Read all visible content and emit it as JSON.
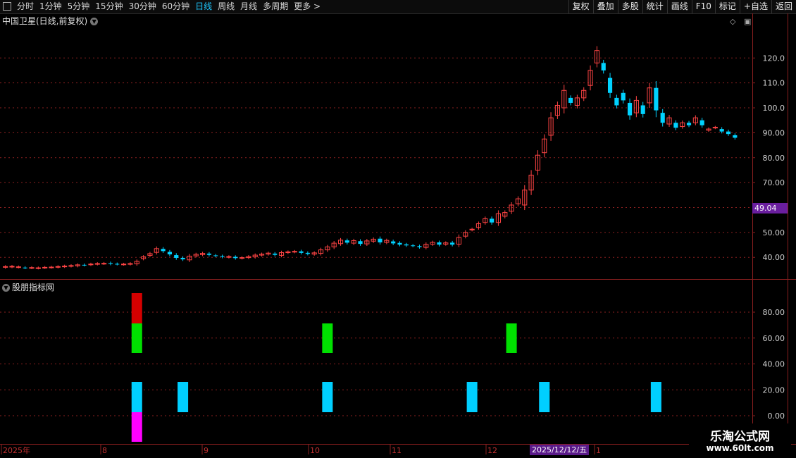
{
  "toolbar": {
    "tabs": [
      "分时",
      "1分钟",
      "5分钟",
      "15分钟",
      "30分钟",
      "60分钟",
      "日线",
      "周线",
      "月线",
      "多周期",
      "更多 >"
    ],
    "active_tab": "日线",
    "right_buttons": [
      "复权",
      "叠加",
      "多股",
      "统计",
      "画线",
      "F10",
      "标记",
      "+自选",
      "返回"
    ]
  },
  "main": {
    "title": "中国卫星(日线,前复权)",
    "current_price": "49.04",
    "y_ticks": [
      "120.0",
      "110.0",
      "100.0",
      "90.00",
      "80.00",
      "70.00",
      "60.00",
      "50.00",
      "40.00"
    ]
  },
  "indicator": {
    "title": "股朋指标网",
    "y_ticks": [
      "80.00",
      "60.00",
      "40.00",
      "20.00",
      "0.00"
    ]
  },
  "x_axis": {
    "labels": [
      "2025年",
      "8",
      "9",
      "10",
      "11",
      "12",
      "1"
    ],
    "selected_date": "2025/12/12/五"
  },
  "watermark": {
    "name": "乐淘公式网",
    "url": "www.60lt.com"
  },
  "colors": {
    "up": "#ff4444",
    "down": "#00d2ff",
    "grid": "#8a1f1f",
    "bar_red": "#d40000",
    "bar_green": "#00e000",
    "bar_cyan": "#00cfff",
    "bar_magenta": "#ff00ff"
  },
  "chart_data": {
    "type": "candlestick",
    "price_range": [
      33,
      128
    ],
    "candles": [
      {
        "o": 36,
        "c": 36.3
      },
      {
        "o": 36.2,
        "c": 36.4
      },
      {
        "o": 36.1,
        "c": 36.2
      },
      {
        "o": 35.9,
        "c": 35.8
      },
      {
        "o": 35.8,
        "c": 35.9
      },
      {
        "o": 35.7,
        "c": 35.8
      },
      {
        "o": 35.9,
        "c": 36.0
      },
      {
        "o": 36.0,
        "c": 36.1
      },
      {
        "o": 36.1,
        "c": 36.3
      },
      {
        "o": 36.3,
        "c": 36.5
      },
      {
        "o": 36.5,
        "c": 36.7
      },
      {
        "o": 36.6,
        "c": 37.0
      },
      {
        "o": 37.0,
        "c": 36.9
      },
      {
        "o": 37.1,
        "c": 37.3
      },
      {
        "o": 37.3,
        "c": 37.5
      },
      {
        "o": 37.5,
        "c": 37.6
      },
      {
        "o": 37.7,
        "c": 37.4
      },
      {
        "o": 37.4,
        "c": 37.3
      },
      {
        "o": 37.2,
        "c": 37.3
      },
      {
        "o": 37.3,
        "c": 37.5
      },
      {
        "o": 37.4,
        "c": 38.4
      },
      {
        "o": 39.5,
        "c": 40.2
      },
      {
        "o": 40.8,
        "c": 41.5
      },
      {
        "o": 42.0,
        "c": 43.5
      },
      {
        "o": 43.4,
        "c": 42.5
      },
      {
        "o": 42.2,
        "c": 41.2
      },
      {
        "o": 40.9,
        "c": 39.8
      },
      {
        "o": 39.8,
        "c": 39.2
      },
      {
        "o": 39.0,
        "c": 40.5
      },
      {
        "o": 40.6,
        "c": 41.2
      },
      {
        "o": 41.1,
        "c": 41.6
      },
      {
        "o": 41.5,
        "c": 41.0
      },
      {
        "o": 40.8,
        "c": 40.6
      },
      {
        "o": 40.5,
        "c": 40.2
      },
      {
        "o": 40.1,
        "c": 40.3
      },
      {
        "o": 40.2,
        "c": 39.7
      },
      {
        "o": 39.7,
        "c": 39.9
      },
      {
        "o": 39.9,
        "c": 40.3
      },
      {
        "o": 40.2,
        "c": 40.9
      },
      {
        "o": 40.9,
        "c": 41.3
      },
      {
        "o": 41.3,
        "c": 41.7
      },
      {
        "o": 41.5,
        "c": 41.0
      },
      {
        "o": 40.8,
        "c": 41.9
      },
      {
        "o": 41.9,
        "c": 42.2
      },
      {
        "o": 42.2,
        "c": 42.4
      },
      {
        "o": 42.4,
        "c": 41.8
      },
      {
        "o": 41.8,
        "c": 41.4
      },
      {
        "o": 41.3,
        "c": 41.8
      },
      {
        "o": 41.6,
        "c": 43.0
      },
      {
        "o": 43.0,
        "c": 44.2
      },
      {
        "o": 44.2,
        "c": 45.7
      },
      {
        "o": 45.5,
        "c": 46.9
      },
      {
        "o": 46.8,
        "c": 45.9
      },
      {
        "o": 45.7,
        "c": 46.7
      },
      {
        "o": 46.5,
        "c": 45.4
      },
      {
        "o": 45.4,
        "c": 46.6
      },
      {
        "o": 46.5,
        "c": 47.3
      },
      {
        "o": 47.5,
        "c": 46.0
      },
      {
        "o": 46.0,
        "c": 46.8
      },
      {
        "o": 46.4,
        "c": 45.6
      },
      {
        "o": 45.8,
        "c": 45.1
      },
      {
        "o": 45.2,
        "c": 44.8
      },
      {
        "o": 44.8,
        "c": 44.6
      },
      {
        "o": 44.5,
        "c": 44.1
      },
      {
        "o": 44.0,
        "c": 45.2
      },
      {
        "o": 45.3,
        "c": 46.0
      },
      {
        "o": 46.0,
        "c": 45.1
      },
      {
        "o": 45.3,
        "c": 45.8
      },
      {
        "o": 45.9,
        "c": 45.1
      },
      {
        "o": 45.3,
        "c": 48.0
      },
      {
        "o": 48.5,
        "c": 50.0
      },
      {
        "o": 51.0,
        "c": 51.3
      },
      {
        "o": 52.0,
        "c": 53.5
      },
      {
        "o": 54.0,
        "c": 55.5
      },
      {
        "o": 55.5,
        "c": 54.0
      },
      {
        "o": 54.0,
        "c": 57.5
      },
      {
        "o": 56.5,
        "c": 58.0
      },
      {
        "o": 58.5,
        "c": 61.0
      },
      {
        "o": 61.5,
        "c": 63.5
      },
      {
        "o": 61.0,
        "c": 67.0
      },
      {
        "o": 67.0,
        "c": 73.0
      },
      {
        "o": 75.0,
        "c": 81.0
      },
      {
        "o": 82.0,
        "c": 87.5
      },
      {
        "o": 89.0,
        "c": 96.0
      },
      {
        "o": 97.0,
        "c": 101.0
      },
      {
        "o": 100.0,
        "c": 107.0
      },
      {
        "o": 104.0,
        "c": 102.0
      },
      {
        "o": 101.0,
        "c": 104.0
      },
      {
        "o": 104.0,
        "c": 107.0
      },
      {
        "o": 109.0,
        "c": 115.0
      },
      {
        "o": 118.0,
        "c": 123.0
      },
      {
        "o": 118.0,
        "c": 115.0
      },
      {
        "o": 112.0,
        "c": 106.0
      },
      {
        "o": 104.0,
        "c": 101.0
      },
      {
        "o": 106.0,
        "c": 103.0
      },
      {
        "o": 102.0,
        "c": 97.0
      },
      {
        "o": 98.0,
        "c": 103.0
      },
      {
        "o": 101.0,
        "c": 97.5
      },
      {
        "o": 102.0,
        "c": 108.0
      },
      {
        "o": 108.0,
        "c": 99.0
      },
      {
        "o": 98.0,
        "c": 94.0
      },
      {
        "o": 93.5,
        "c": 96.0
      },
      {
        "o": 94.0,
        "c": 92.0
      },
      {
        "o": 92.5,
        "c": 94.0
      },
      {
        "o": 94.0,
        "c": 93.0
      },
      {
        "o": 94.0,
        "c": 96.0
      },
      {
        "o": 95.0,
        "c": 93.0
      },
      {
        "o": 91.0,
        "c": 91.5
      },
      {
        "o": 92.0,
        "c": 92.2
      },
      {
        "o": 91.5,
        "c": 90.5
      },
      {
        "o": 90.5,
        "c": 89.5
      },
      {
        "o": 89.0,
        "c": 88.0
      }
    ],
    "signals": [
      {
        "candle": 20,
        "band": "top",
        "color": "bar_red",
        "value": 95
      },
      {
        "candle": 20,
        "band": "upper",
        "color": "bar_green",
        "value": 70
      },
      {
        "candle": 49,
        "band": "upper",
        "color": "bar_green",
        "value": 70
      },
      {
        "candle": 77,
        "band": "upper",
        "color": "bar_green",
        "value": 70
      },
      {
        "candle": 20,
        "band": "lower",
        "color": "bar_cyan",
        "value": 25
      },
      {
        "candle": 27,
        "band": "lower",
        "color": "bar_cyan",
        "value": 25
      },
      {
        "candle": 49,
        "band": "lower",
        "color": "bar_cyan",
        "value": 25
      },
      {
        "candle": 71,
        "band": "lower",
        "color": "bar_cyan",
        "value": 25
      },
      {
        "candle": 82,
        "band": "lower",
        "color": "bar_cyan",
        "value": 25
      },
      {
        "candle": 99,
        "band": "lower",
        "color": "bar_cyan",
        "value": 25
      },
      {
        "candle": 20,
        "band": "bottom",
        "color": "bar_magenta",
        "value": -5
      }
    ]
  }
}
